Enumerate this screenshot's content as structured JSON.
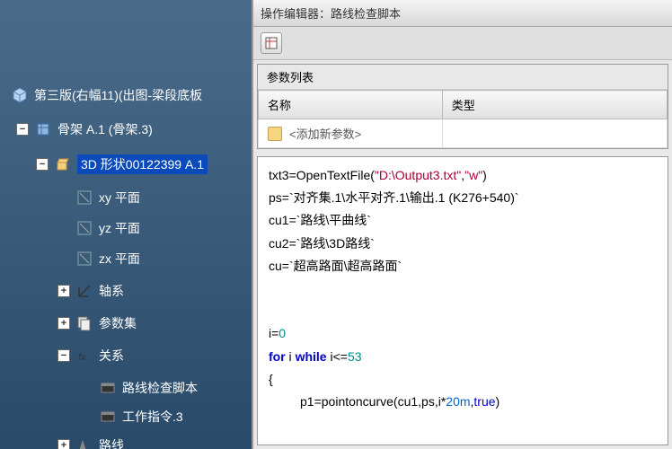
{
  "editor": {
    "title_prefix": "操作编辑器：",
    "title_name": "路线检查脚本",
    "param_section": "参数列表",
    "col_name": "名称",
    "col_type": "类型",
    "add_param": "<添加新参数>"
  },
  "tree": {
    "root": "第三版(右幅11)(出图-梁段底板",
    "frame": "骨架 A.1 (骨架.3)",
    "shape3d": "3D 形状00122399 A.1",
    "xy": "xy 平面",
    "yz": "yz 平面",
    "zx": "zx 平面",
    "axis": "轴系",
    "paramset": "参数集",
    "relation": "关系",
    "script": "路线检查脚本",
    "workcmd": "工作指令.3",
    "route": "路线"
  },
  "code": {
    "l1a": "txt3=OpenTextFile(",
    "l1b": "\"D:\\Output3.txt\"",
    "l1c": ",",
    "l1d": "\"w\"",
    "l1e": ")",
    "l2": "ps=`对齐集.1\\水平对齐.1\\输出.1 (K276+540)`",
    "l3": "cu1=`路线\\平曲线`",
    "l4": "cu2=`路线\\3D路线`",
    "l5": "cu=`超高路面\\超高路面`",
    "l6a": "i=",
    "l6b": "0",
    "l7a": "for",
    "l7b": " i ",
    "l7c": "while",
    "l7d": " i<=",
    "l7e": "53",
    "l8": "{",
    "l9a": "         p1=pointoncurve(cu1,ps,i*",
    "l9b": "20m",
    "l9c": ",",
    "l9d": "true",
    "l9e": ")"
  }
}
